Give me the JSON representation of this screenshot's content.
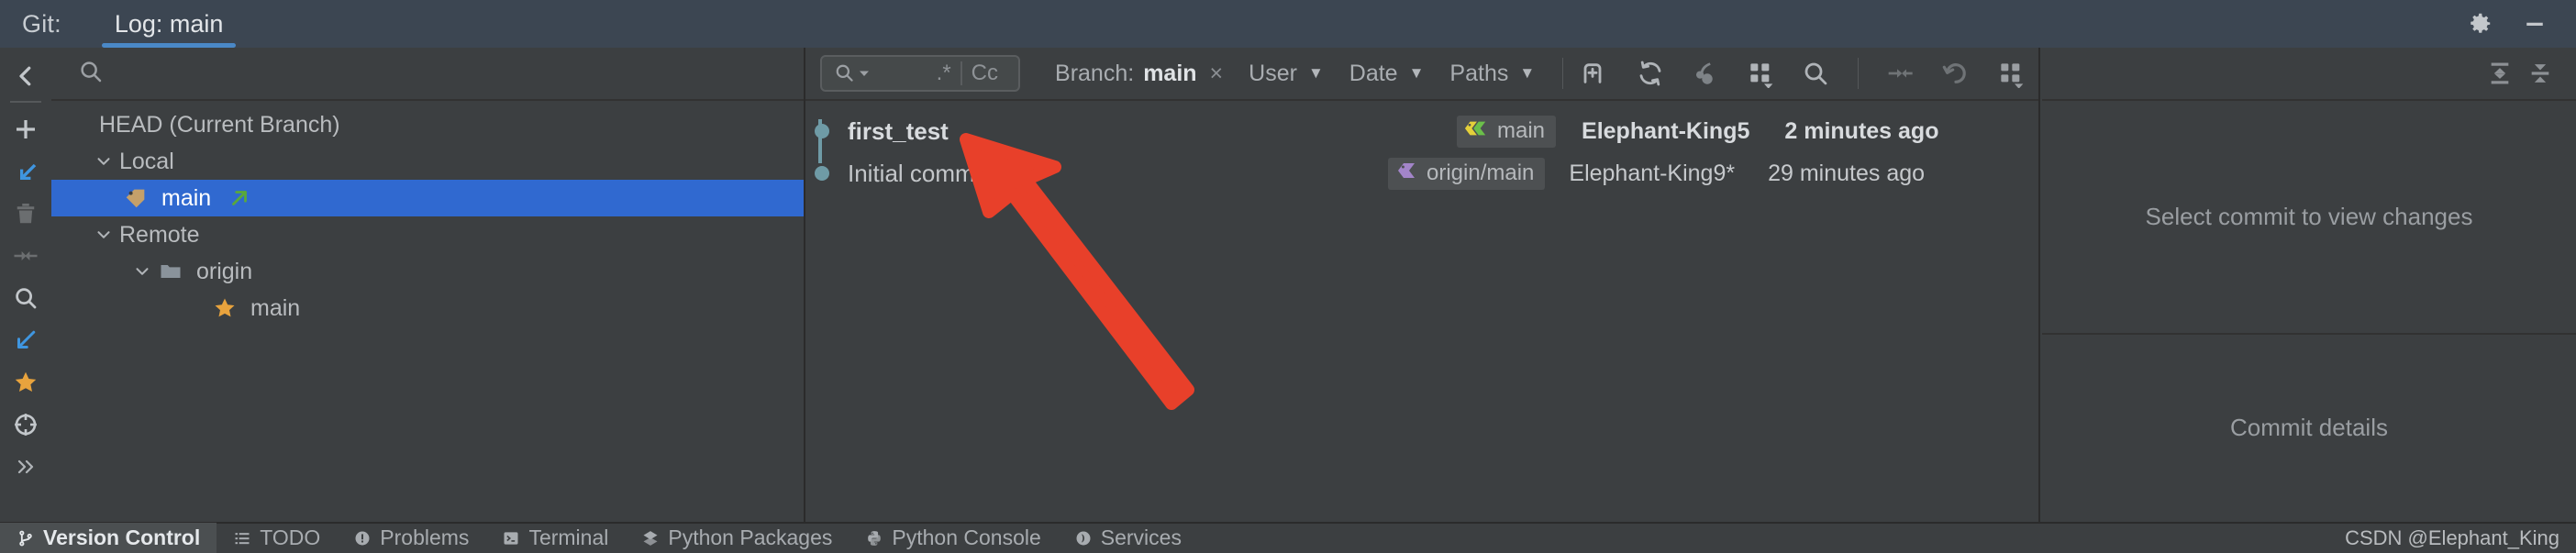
{
  "titlebar": {
    "git_label": "Git:",
    "tabs": [
      {
        "label": "Log: main",
        "active": true
      }
    ],
    "gear_icon": "gear-icon",
    "minimize_icon": "minimize-icon"
  },
  "left_toolbar": {
    "items": [
      {
        "name": "back-icon",
        "title": "Back"
      },
      {
        "name": "add-icon",
        "title": "New Branch"
      },
      {
        "name": "update-project-icon",
        "title": "Update Project"
      },
      {
        "name": "delete-icon",
        "title": "Delete"
      },
      {
        "name": "merge-icon",
        "title": "Merge"
      },
      {
        "name": "search-icon",
        "title": "Search"
      },
      {
        "name": "rebase-icon",
        "title": "Rebase"
      },
      {
        "name": "favorite-star-icon",
        "title": "Favorite"
      },
      {
        "name": "target-icon",
        "title": "Show Current"
      },
      {
        "name": "more-icon",
        "title": "More"
      }
    ]
  },
  "branch_panel": {
    "search_placeholder": "",
    "search_icon": "search-icon",
    "tree": [
      {
        "label": "HEAD (Current Branch)",
        "indent": 0,
        "chevron": "",
        "icon": "",
        "selected": false
      },
      {
        "label": "Local",
        "indent": 1,
        "chevron": "v",
        "icon": "",
        "selected": false
      },
      {
        "label": "main",
        "indent": 2,
        "chevron": "",
        "icon": "tag-icon",
        "selected": true,
        "trailing_icon": "arrow-up-right-icon"
      },
      {
        "label": "Remote",
        "indent": 1,
        "chevron": "v",
        "icon": "",
        "selected": false
      },
      {
        "label": "origin",
        "indent": 2,
        "chevron": "v",
        "icon": "folder-icon",
        "selected": false
      },
      {
        "label": "main",
        "indent": 3,
        "chevron": "",
        "icon": "star-icon",
        "selected": false
      }
    ]
  },
  "log_toolbar": {
    "search_value": "",
    "search_icon": "search-dropdown-icon",
    "regex_button": ".*",
    "matchcase_button": "Cc",
    "filters": [
      {
        "name": "branch-filter",
        "label": "Branch:",
        "value": "main",
        "clear": "×",
        "caret": false
      },
      {
        "name": "user-filter",
        "label": "User",
        "value": "",
        "caret": true
      },
      {
        "name": "date-filter",
        "label": "Date",
        "value": "",
        "caret": true
      },
      {
        "name": "paths-filter",
        "label": "Paths",
        "value": "",
        "caret": true
      }
    ],
    "icons_left": [
      {
        "name": "new-branch-icon"
      }
    ],
    "icons_mid": [
      {
        "name": "refresh-icon"
      },
      {
        "name": "cherry-pick-icon"
      },
      {
        "name": "show-options-icon"
      },
      {
        "name": "search-icon"
      }
    ],
    "icons_right": [
      {
        "name": "collapse-into-icon"
      },
      {
        "name": "revert-icon"
      },
      {
        "name": "grid-options-icon"
      }
    ]
  },
  "commits": [
    {
      "subject": "first_test",
      "ref": "main",
      "ref_icon": "branch-label-icon",
      "author": "Elephant-King5",
      "date": "2 minutes ago",
      "head": true,
      "node_color": "#6f9ba6"
    },
    {
      "subject": "Initial commit",
      "ref": "origin/main",
      "ref_icon": "remote-label-icon",
      "author": "Elephant-King9*",
      "date": "29 minutes ago",
      "head": false,
      "node_color": "#6f9ba6"
    }
  ],
  "right_pane": {
    "toolbar_icons": [
      {
        "name": "expand-all-icon"
      },
      {
        "name": "collapse-all-icon"
      }
    ],
    "changes_placeholder": "Select commit to view changes",
    "details_placeholder": "Commit details"
  },
  "bottom_bar": {
    "items": [
      {
        "label": "Version Control",
        "icon": "branch-icon",
        "active": true
      },
      {
        "label": "TODO",
        "icon": "todo-icon",
        "active": false
      },
      {
        "label": "Problems",
        "icon": "problems-icon",
        "active": false
      },
      {
        "label": "Terminal",
        "icon": "terminal-icon",
        "active": false
      },
      {
        "label": "Python Packages",
        "icon": "packages-icon",
        "active": false
      },
      {
        "label": "Python Console",
        "icon": "python-console-icon",
        "active": false
      },
      {
        "label": "Services",
        "icon": "services-icon",
        "active": false
      }
    ],
    "watermark": "CSDN @Elephant_King"
  },
  "annotation": {
    "type": "red-arrow",
    "color": "#e8402a"
  },
  "colors": {
    "accent_blue": "#3069d0",
    "tab_underline": "#4a88c7",
    "titlebar_bg": "#3c4652",
    "panel_bg": "#3c3f41",
    "graph_node": "#6f9ba6",
    "star_gold": "#e8a33d",
    "tag_tan": "#c4a06a",
    "arrow_green": "#59a83c",
    "annotation_red": "#e8402a"
  }
}
